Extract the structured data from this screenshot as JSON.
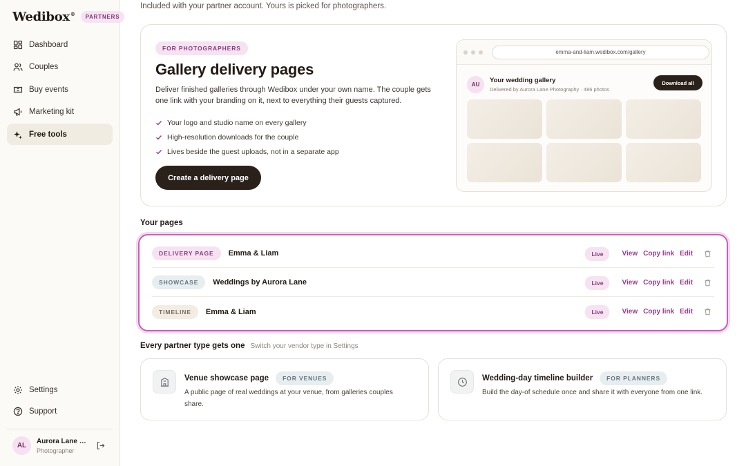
{
  "brand": {
    "name": "Wedibox",
    "mark": "®",
    "badge": "PARTNERS"
  },
  "nav": {
    "items": [
      {
        "label": "Dashboard",
        "icon": "grid-icon"
      },
      {
        "label": "Couples",
        "icon": "users-icon"
      },
      {
        "label": "Buy events",
        "icon": "ticket-icon"
      },
      {
        "label": "Marketing kit",
        "icon": "megaphone-icon"
      },
      {
        "label": "Free tools",
        "icon": "sparkle-icon",
        "active": true
      }
    ],
    "bottom": [
      {
        "label": "Settings",
        "icon": "gear-icon"
      },
      {
        "label": "Support",
        "icon": "help-icon"
      }
    ]
  },
  "user": {
    "initials": "AL",
    "name": "Aurora Lane Photography",
    "role": "Photographer"
  },
  "intro": "Included with your partner account. Yours is picked for photographers.",
  "hero": {
    "chip": "FOR PHOTOGRAPHERS",
    "title": "Gallery delivery pages",
    "description": "Deliver finished galleries through Wedibox under your own name. The couple gets one link with your branding on it, next to everything their guests captured.",
    "bullets": [
      "Your logo and studio name on every gallery",
      "High-resolution downloads for the couple",
      "Lives beside the guest uploads, not in a separate app"
    ],
    "cta": "Create a delivery page",
    "preview": {
      "url": "emma-and-liam.wedibox.com/gallery",
      "initials": "AU",
      "title": "Your wedding gallery",
      "subtitle": "Delivered by Aurora Lane Photography · 486 photos",
      "button": "Download all"
    }
  },
  "pages": {
    "title": "Your pages",
    "rows": [
      {
        "type": "DELIVERY PAGE",
        "name": "Emma & Liam",
        "status": "Live"
      },
      {
        "type": "SHOWCASE",
        "name": "Weddings by Aurora Lane",
        "status": "Live"
      },
      {
        "type": "TIMELINE",
        "name": "Emma & Liam",
        "status": "Live"
      }
    ],
    "actions": {
      "view": "View",
      "copy": "Copy link",
      "edit": "Edit"
    }
  },
  "partner_types": {
    "title": "Every partner type gets one",
    "hint": "Switch your vendor type in Settings",
    "cards": [
      {
        "title": "Venue showcase page",
        "chip": "FOR VENUES",
        "description": "A public page of real weddings at your venue, from galleries couples share.",
        "icon": "building-icon"
      },
      {
        "title": "Wedding-day timeline builder",
        "chip": "FOR PLANNERS",
        "description": "Build the day-of schedule once and share it with everyone from one link.",
        "icon": "clock-icon"
      }
    ]
  },
  "colors": {
    "accent": "#9a3a8d",
    "dark": "#2a211b",
    "highlight": "#c95ebc"
  }
}
